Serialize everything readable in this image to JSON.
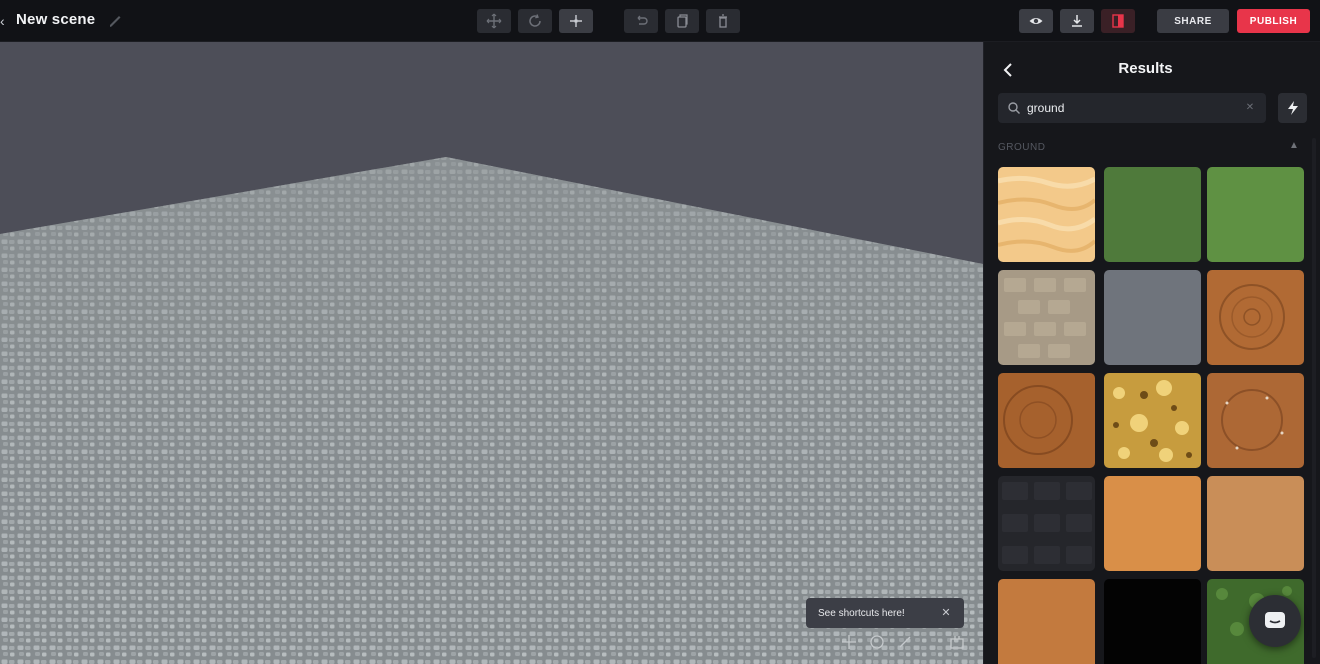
{
  "header": {
    "scene_title": "New scene",
    "share_label": "SHARE",
    "publish_label": "PUBLISH"
  },
  "toolbar": {
    "transform_tools": [
      "move-icon",
      "rotate-icon",
      "scale-icon"
    ],
    "edit_tools": [
      "undo-icon",
      "duplicate-icon",
      "delete-icon"
    ],
    "view_tools": [
      "preview-eye-icon",
      "download-icon",
      "panel-toggle-icon"
    ]
  },
  "viewport": {
    "toast_text": "See shortcuts here!",
    "bottom_icons": [
      "move-gizmo-icon",
      "orbit-icon",
      "pan-icon",
      "grid-icon"
    ]
  },
  "panel": {
    "title": "Results",
    "search_value": "ground",
    "section_label": "GROUND",
    "tiles": [
      {
        "name": "sand-ripples-texture",
        "base": "#f3c98a"
      },
      {
        "name": "dark-green-texture",
        "base": "#4f7a3b"
      },
      {
        "name": "light-green-texture",
        "base": "#5f9143"
      },
      {
        "name": "beige-paving-texture",
        "base": "#a79a86"
      },
      {
        "name": "slate-grey-texture",
        "base": "#6f747c"
      },
      {
        "name": "brown-dirt-ring-texture",
        "base": "#b16a34"
      },
      {
        "name": "brown-dirt-ring-texture-2",
        "base": "#a6612d"
      },
      {
        "name": "golden-rock-texture",
        "base": "#c79c3e"
      },
      {
        "name": "brown-dirt-pebbles-texture",
        "base": "#ad6835"
      },
      {
        "name": "dark-tiles-texture",
        "base": "#25262b"
      },
      {
        "name": "orange-clay-texture",
        "base": "#d98f48"
      },
      {
        "name": "tan-clay-texture",
        "base": "#c98e58"
      },
      {
        "name": "terracotta-texture",
        "base": "#c37a3e"
      },
      {
        "name": "black-texture",
        "base": "#030303"
      },
      {
        "name": "grass-texture",
        "base": "#3f6a2c"
      }
    ]
  },
  "colors": {
    "accent": "#e8354a",
    "panel_bg": "#16171b",
    "viewport_sky": "#4d4e58",
    "floor": "#8a9092"
  }
}
